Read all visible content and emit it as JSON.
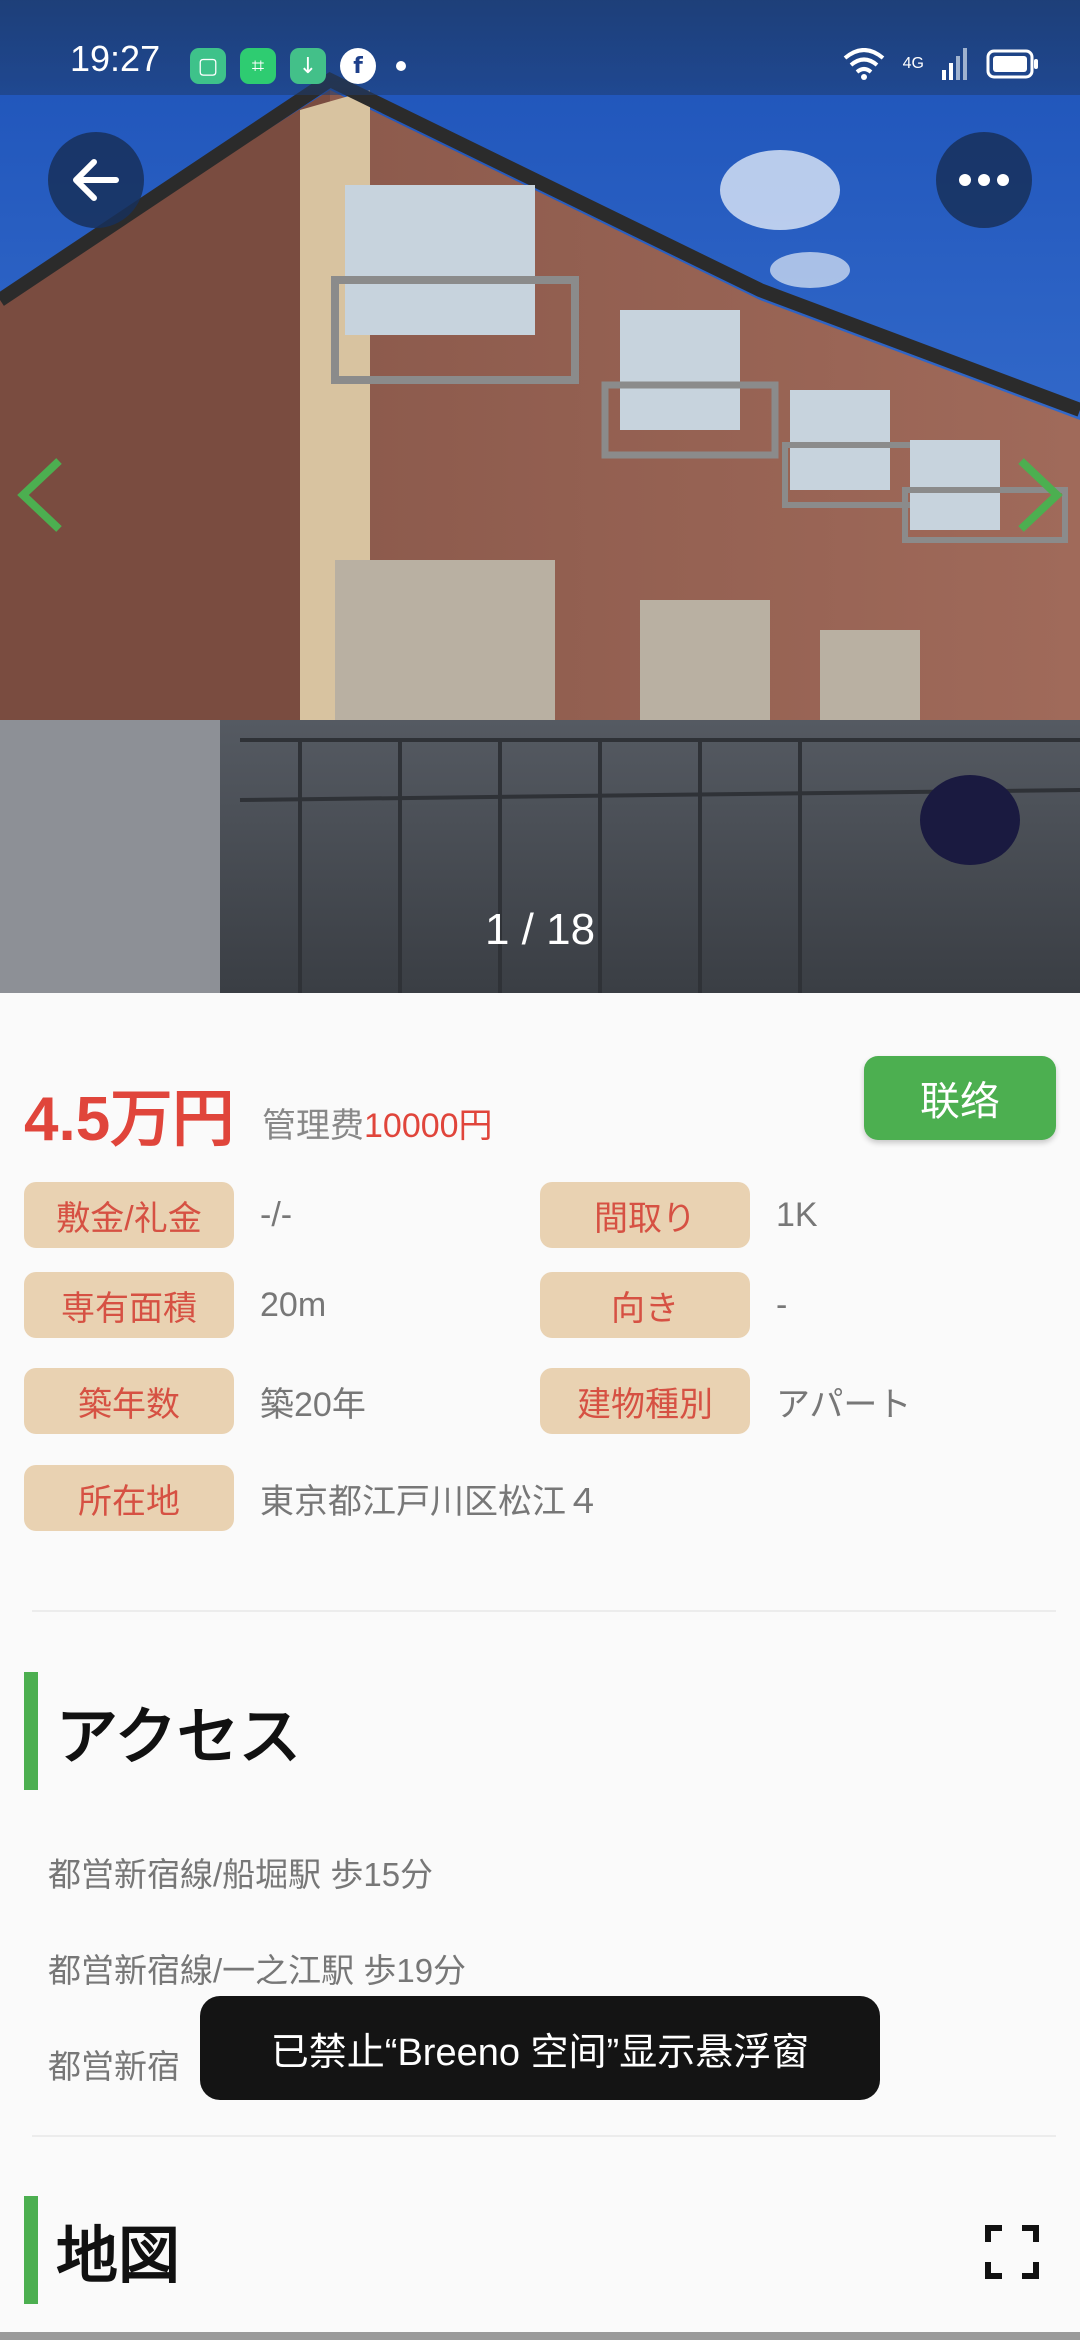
{
  "status_bar": {
    "time": "19:27",
    "network": "4G",
    "apps": [
      "tile-icon",
      "qr-icon",
      "download-icon",
      "facebook-icon"
    ]
  },
  "gallery": {
    "counter": "1 / 18",
    "current_index": 1,
    "total": 18
  },
  "listing": {
    "price": "4.5万円",
    "fee_label": "管理费",
    "fee_value": "10000円",
    "contact_label": "联络"
  },
  "attributes": [
    {
      "label": "敷金/礼金",
      "value": "-/-"
    },
    {
      "label": "間取り",
      "value": "1K"
    },
    {
      "label": "専有面積",
      "value": "20m"
    },
    {
      "label": "向き",
      "value": "-"
    },
    {
      "label": "築年数",
      "value": "築20年"
    },
    {
      "label": "建物種別",
      "value": "アパート"
    },
    {
      "label": "所在地",
      "value": "東京都江戸川区松江４"
    }
  ],
  "access": {
    "title": "アクセス",
    "items": [
      "都営新宿線/船堀駅 歩15分",
      "都営新宿線/一之江駅 歩19分",
      "都営新宿"
    ]
  },
  "map": {
    "title": "地図"
  },
  "toast": {
    "text": "已禁止“Breeno 空间”显示悬浮窗"
  },
  "colors": {
    "accent_green": "#4caf50",
    "price_red": "#e0453b",
    "tag_bg": "#e9d2b2"
  }
}
